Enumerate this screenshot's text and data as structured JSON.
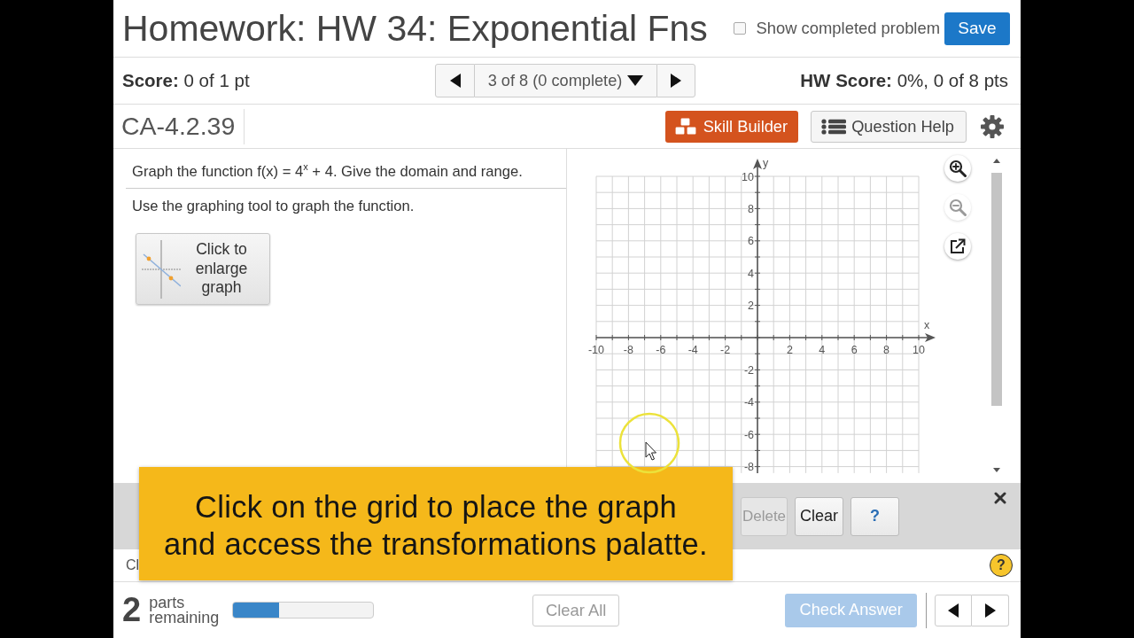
{
  "header": {
    "title": "Homework: HW 34: Exponential Fns",
    "show_completed": {
      "label": "Show completed problem",
      "checked": false
    },
    "save_button": "Save"
  },
  "score_bar": {
    "score": "**Score:** 0 of 1 pt",
    "question_selector": "3 of 8 (0 complete)",
    "hw_score": "**HW Score:** 0%, 0 of 8 pts"
  },
  "question_bar": {
    "question_id": "CA-4.2.39",
    "buttons": [
      {
        "kind": "skill",
        "label": "Skill Builder"
      },
      {
        "kind": "help",
        "label": "Question Help"
      }
    ]
  },
  "question": {
    "prompt": "Graph the function f(x) = 4$^{x}$ + 4. Give the domain and range.",
    "instruction": "Use the graphing tool to graph the function.",
    "enlarge_button": "Click to enlarge graph"
  },
  "graph": {
    "x_axis": {
      "label": "x",
      "tick_labels": [
        "-10",
        "-8",
        "-6",
        "-4",
        "-2",
        "2",
        "4",
        "6",
        "8",
        "10"
      ]
    },
    "y_axis": {
      "label": "y",
      "tick_labels": [
        "10",
        "8",
        "6",
        "4",
        "2",
        "-2",
        "-4",
        "-6",
        "-8"
      ]
    },
    "tools": [
      {
        "kind": "zoom_in",
        "disabled": false
      },
      {
        "kind": "zoom_out",
        "disabled": true
      },
      {
        "kind": "popout",
        "disabled": false
      }
    ]
  },
  "toolbar": {
    "buttons": [
      {
        "kind": "action",
        "label": "Delete",
        "disabled": true
      },
      {
        "kind": "action",
        "label": "Clear",
        "disabled": false
      },
      {
        "kind": "help",
        "label": "?",
        "disabled": false
      }
    ]
  },
  "hint_row": {
    "text": "Cl",
    "help_button": "?"
  },
  "footer": {
    "parts_count": "2",
    "parts_label": "parts remaining",
    "progress": {
      "level": 0.33
    },
    "clear_all": "Clear All",
    "check_answer": {
      "label": "Check Answer",
      "disabled": true
    }
  },
  "tooltip": {
    "lines": [
      "Click on the grid to place the graph",
      "and access the transformations palatte."
    ]
  }
}
